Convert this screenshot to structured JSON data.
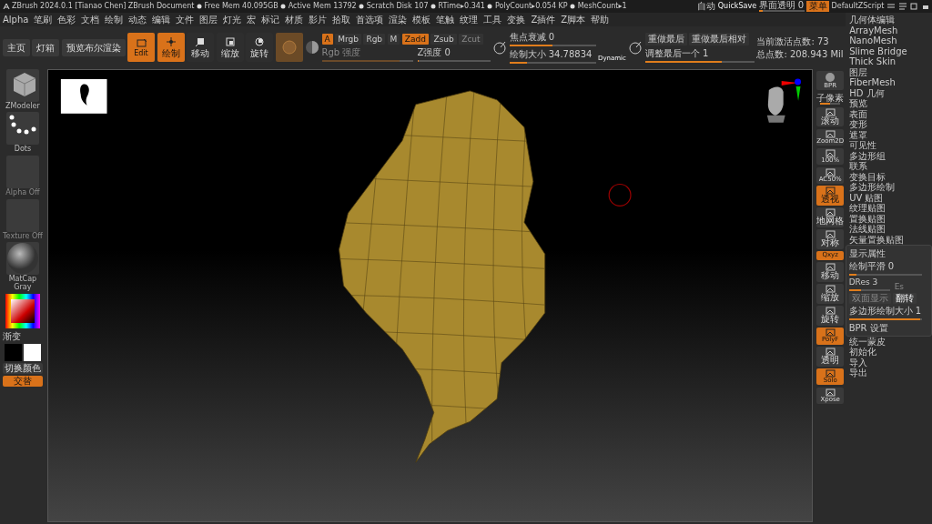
{
  "title_bar": {
    "app": "ZBrush 2024.0.1 [Tianao Chen]",
    "document": "ZBrush Document",
    "stats": [
      "Free Mem 40.095GB",
      "Active Mem 13792",
      "Scratch Disk 107",
      "RTime▸0.341",
      "PolyCount▸0.054 KP",
      "MeshCount▸1"
    ],
    "auto": "自动",
    "quicksave": "QuickSave",
    "opacity": {
      "label": "界面透明 0",
      "level": 0.08
    },
    "menu_button": {
      "label": "菜单",
      "selected": true
    },
    "script": "DefaultZScript"
  },
  "menu_bar": [
    "Alpha",
    "笔刷",
    "色彩",
    "文档",
    "绘制",
    "动态",
    "编辑",
    "文件",
    "图层",
    "灯光",
    "宏",
    "标记",
    "材质",
    "影片",
    "拾取",
    "首选项",
    "渲染",
    "模板",
    "笔触",
    "纹理",
    "工具",
    "变换",
    "Z插件",
    "Z脚本",
    "帮助"
  ],
  "toolbar": {
    "nav": [
      "主页",
      "灯箱",
      "预览布尔渲染"
    ],
    "modes": [
      {
        "label": "Edit",
        "kind": "edit",
        "selected": true
      },
      {
        "label": "绘制",
        "kind": "draw",
        "selected": true
      },
      {
        "label": "移动",
        "kind": "move",
        "selected": false
      },
      {
        "label": "缩放",
        "kind": "scale",
        "selected": false
      },
      {
        "label": "旋转",
        "kind": "rotate",
        "selected": false
      }
    ],
    "channels": [
      {
        "label": "A",
        "selected": true
      },
      {
        "label": "Mrgb",
        "selected": false
      },
      {
        "label": "Rgb",
        "selected": false
      },
      {
        "label": "M",
        "selected": false
      },
      {
        "label": "Zadd",
        "selected": true
      },
      {
        "label": "Zsub",
        "selected": false
      },
      {
        "label": "Zcut",
        "selected": false,
        "disabled": true
      }
    ],
    "rgb_intensity": {
      "label": "Rgb 强度",
      "level": 0.85,
      "disabled": true
    },
    "z_intensity": {
      "label": "Z强度 0",
      "level": 0.02
    },
    "focal": {
      "label": "焦点衰减 0",
      "level": 0.5
    },
    "draw_size": {
      "label": "绘制大小 34.78834",
      "level": 0.2
    },
    "dynamic": "Dynamic",
    "redo": [
      "重做最后",
      "重做最后相对"
    ],
    "adjust": {
      "label": "调整最后一个 1",
      "level": 0.7
    },
    "active_points": "当前激活点数: 73",
    "total_points": "总点数: 208.943 Mil"
  },
  "left_shelf": {
    "tiles": [
      {
        "label": "ZModeler",
        "kind": "brush"
      },
      {
        "label": "Dots",
        "kind": "stroke"
      },
      {
        "label": "Alpha Off",
        "kind": "empty"
      },
      {
        "label": "Texture Off",
        "kind": "empty"
      },
      {
        "label": "MatCap Gray",
        "kind": "material"
      }
    ],
    "gradient": "渐变",
    "switch_color": "切换颜色",
    "alternate": {
      "label": "交替",
      "selected": true
    }
  },
  "right_tools": [
    {
      "label": "BPR",
      "kind": "sphere",
      "selected": false
    },
    {
      "label": "滚动",
      "kind": "tool",
      "selected": false
    },
    {
      "label": "Zoom2D",
      "kind": "tool",
      "selected": false
    },
    {
      "label": "100%",
      "kind": "tool",
      "selected": false
    },
    {
      "label": "AC50%",
      "kind": "tool",
      "selected": false
    },
    {
      "label": "透视",
      "kind": "tool",
      "selected": true
    },
    {
      "label": "地网格",
      "kind": "tool",
      "selected": false
    },
    {
      "label": "对称",
      "kind": "tool",
      "selected": false
    },
    {
      "label": "Qxyz",
      "kind": "small",
      "selected": true
    },
    {
      "label": "移动",
      "kind": "tool",
      "selected": false
    },
    {
      "label": "缩放",
      "kind": "tool",
      "selected": false
    },
    {
      "label": "旋转",
      "kind": "tool",
      "selected": false
    },
    {
      "label": "PolyF",
      "kind": "tool",
      "selected": true
    },
    {
      "label": "透明",
      "kind": "tool",
      "selected": false
    },
    {
      "label": "Solo",
      "kind": "tool",
      "selected": true
    },
    {
      "label": "Xpose",
      "kind": "tool",
      "selected": false
    }
  ],
  "subpixel": {
    "label": "子像素",
    "level": 0.5
  },
  "tool_panel": {
    "items": [
      "几何体编辑",
      "ArrayMesh",
      "NanoMesh",
      "Slime Bridge",
      "Thick Skin",
      "图层",
      "FiberMesh",
      "HD 几何",
      "预览",
      "表面",
      "变形",
      "遮罩",
      "可见性",
      "多边形组",
      "联系",
      "变换目标",
      "多边形绘制",
      "UV 贴图",
      "纹理贴图",
      "置换贴图",
      "法线贴图",
      "矢量置换贴图"
    ],
    "expanded": {
      "title": "显示属性",
      "smooth": {
        "label": "绘制平滑 0",
        "level": 0.1
      },
      "dres": {
        "label": "DRes 3",
        "level": 0.3
      },
      "es": {
        "label": "Es",
        "disabled": true
      },
      "double": "双面显示",
      "flip": "翻转",
      "poly_size": {
        "label": "多边形绘制大小 1",
        "level": 0.98
      },
      "bpr": "BPR 设置"
    },
    "after": [
      "统一蒙皮",
      "初始化",
      "导入",
      "导出"
    ]
  }
}
